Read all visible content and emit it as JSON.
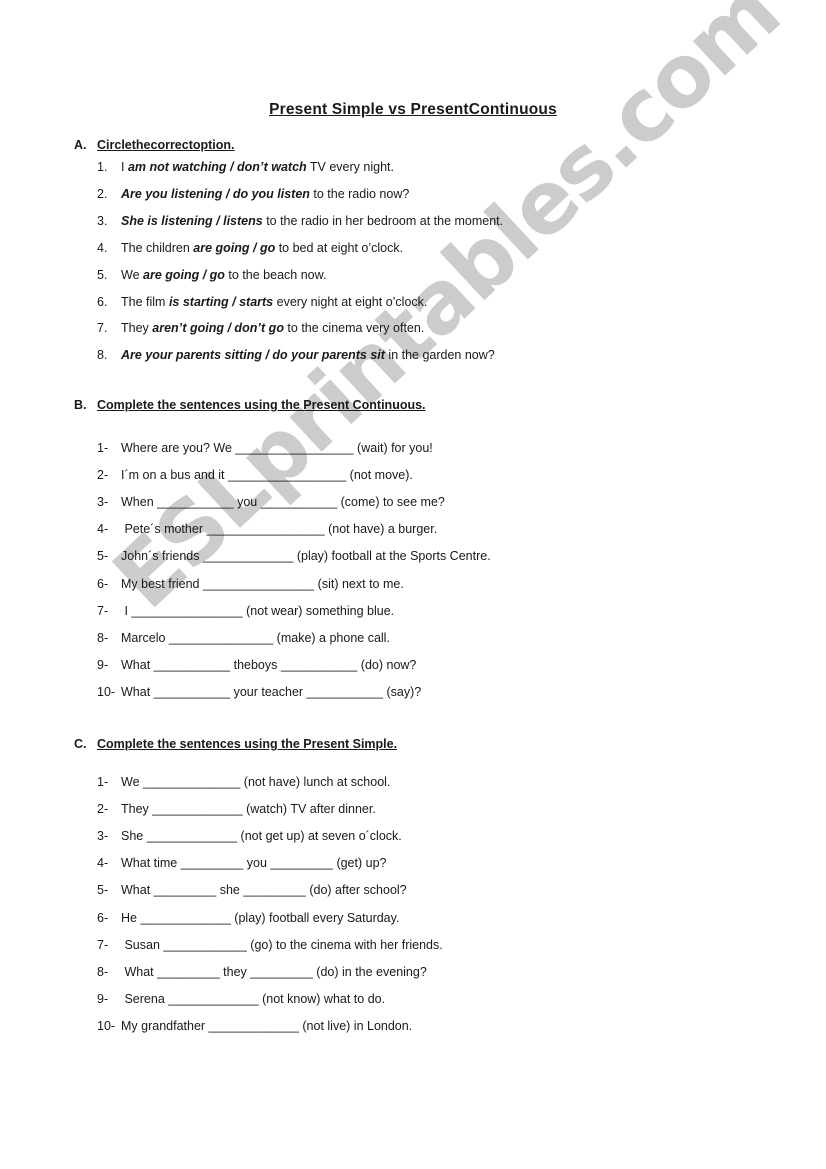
{
  "watermark": "ESLprintables.com",
  "title": "Present Simple vs PresentContinuous",
  "sections": [
    {
      "letter": "A.",
      "instruction": "Circlethecorrectoption.",
      "items": [
        {
          "num": "1.",
          "pre": "I ",
          "opt": "am not watching / don’t watch",
          "post": " TV every night."
        },
        {
          "num": "2.",
          "pre": "",
          "opt": "Are you listening / do you listen",
          "post": " to the radio now?"
        },
        {
          "num": "3.",
          "pre": "",
          "opt": "She is listening / listens",
          "post": " to the radio in her bedroom at the moment."
        },
        {
          "num": "4.",
          "pre": "The children ",
          "opt": "are going / go",
          "post": " to bed at eight o’clock."
        },
        {
          "num": "5.",
          "pre": "We ",
          "opt": "are going / go",
          "post": " to the beach now."
        },
        {
          "num": "6.",
          "pre": "The film ",
          "opt": "is starting / starts",
          "post": " every night at eight o’clock."
        },
        {
          "num": "7.",
          "pre": "They ",
          "opt": "aren’t going / don’t go",
          "post": " to the cinema very often."
        },
        {
          "num": "8.",
          "pre": "",
          "opt": "Are your parents sitting / do your parents sit",
          "post": " in the garden now?"
        }
      ]
    },
    {
      "letter": "B.",
      "instruction": "Complete the sentences using the Present Continuous.",
      "items": [
        {
          "num": "1-",
          "text": "Where are you? We _________________ (wait) for you!"
        },
        {
          "num": "2-",
          "text": "I´m on a bus and it _________________ (not move)."
        },
        {
          "num": "3-",
          "text": "When ___________ you ___________ (come) to see me?"
        },
        {
          "num": "4-",
          "text": " Pete´s mother _________________ (not have) a burger."
        },
        {
          "num": "5-",
          "text": "John´s friends _____________ (play) football at the Sports Centre."
        },
        {
          "num": "6-",
          "text": "My best friend ________________ (sit) next to me."
        },
        {
          "num": "7-",
          "text": " I ________________ (not wear) something blue."
        },
        {
          "num": "8-",
          "text": "Marcelo _______________ (make) a phone call."
        },
        {
          "num": "9-",
          "text": "What ___________ theboys ___________ (do) now?"
        },
        {
          "num": "10-",
          "text": "What ___________ your teacher ___________ (say)?"
        }
      ]
    },
    {
      "letter": "C.",
      "instruction": "Complete the sentences using the Present Simple.",
      "items": [
        {
          "num": "1-",
          "text": "We ______________ (not have) lunch at school."
        },
        {
          "num": "2-",
          "text": "They _____________ (watch) TV after dinner."
        },
        {
          "num": "3-",
          "text": "She _____________ (not get up) at seven o´clock."
        },
        {
          "num": "4-",
          "text": "What time _________ you _________ (get) up?"
        },
        {
          "num": "5-",
          "text": "What _________ she _________ (do) after school?"
        },
        {
          "num": "6-",
          "text": "He _____________ (play) football every Saturday."
        },
        {
          "num": "7-",
          "text": " Susan ____________ (go) to the cinema with her friends."
        },
        {
          "num": "8-",
          "text": " What _________ they _________ (do) in the evening?"
        },
        {
          "num": "9-",
          "text": " Serena _____________ (not know) what to do."
        },
        {
          "num": "10-",
          "text": "My grandfather _____________ (not live) in London."
        }
      ]
    }
  ]
}
